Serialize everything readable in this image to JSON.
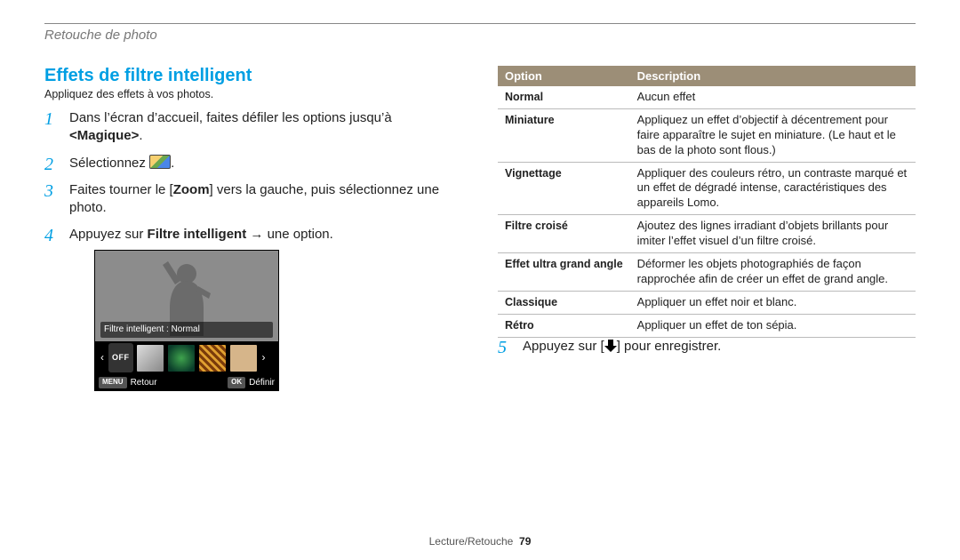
{
  "breadcrumb": "Retouche de photo",
  "section_title": "Effets de filtre intelligent",
  "intro": "Appliquez des effets à vos photos.",
  "steps": {
    "s1_a": "Dans l’écran d’accueil, faites défiler les options jusqu’à ",
    "s1_b": "<Magique>",
    "s1_c": ".",
    "s2_a": "Sélectionnez ",
    "s2_c": ".",
    "s3_a": "Faites tourner le [",
    "s3_b": "Zoom",
    "s3_c": "] vers la gauche, puis sélectionnez une photo.",
    "s4_a": "Appuyez sur ",
    "s4_b": "Filtre intelligent",
    "s4_c": " → une option.",
    "s5_a": "Appuyez sur [",
    "s5_c": "] pour enregistrer."
  },
  "preview": {
    "caption": "Filtre intelligent : Normal",
    "off_label": "OFF",
    "back_btn": "MENU",
    "back_label": "Retour",
    "ok_btn": "OK",
    "ok_label": "Définir"
  },
  "table": {
    "head_option": "Option",
    "head_desc": "Description",
    "rows": [
      {
        "name": "Normal",
        "desc": "Aucun effet"
      },
      {
        "name": "Miniature",
        "desc": "Appliquez un effet d’objectif à décentrement pour faire apparaître le sujet en miniature. (Le haut et le bas de la photo sont flous.)"
      },
      {
        "name": "Vignettage",
        "desc": "Appliquer des couleurs rétro, un contraste marqué et un effet de dégradé intense, caractéristiques des appareils Lomo."
      },
      {
        "name": "Filtre croisé",
        "desc": "Ajoutez des lignes irradiant d’objets brillants pour imiter l’effet visuel d’un filtre croisé."
      },
      {
        "name": "Effet ultra grand angle",
        "desc": "Déformer les objets photographiés de façon rapprochée afin de créer un effet de grand angle."
      },
      {
        "name": "Classique",
        "desc": "Appliquer un effet noir et blanc."
      },
      {
        "name": "Rétro",
        "desc": "Appliquer un effet de ton sépia."
      }
    ]
  },
  "footer": {
    "section": "Lecture/Retouche",
    "page": "79"
  }
}
